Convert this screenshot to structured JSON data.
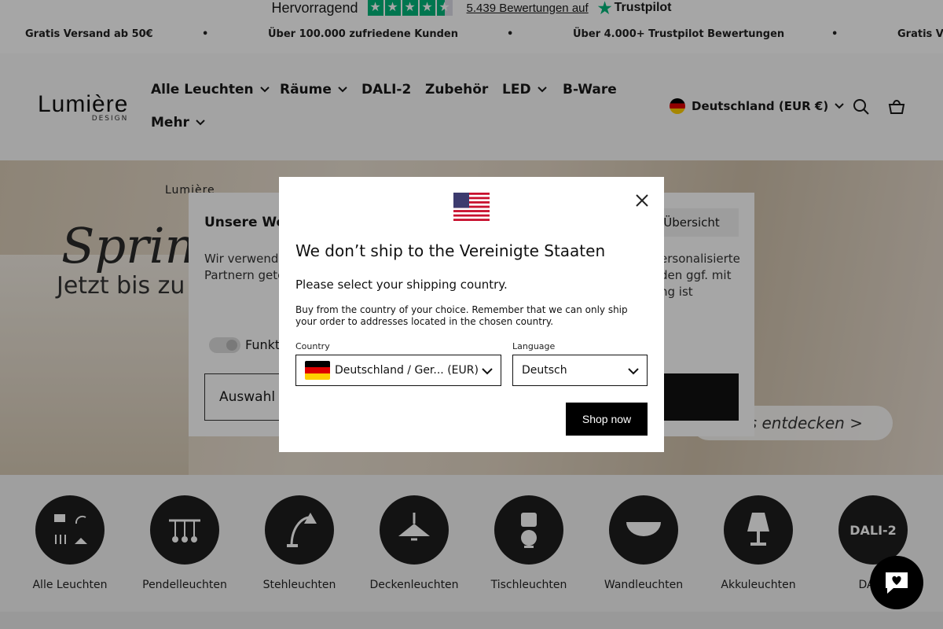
{
  "trustpilot": {
    "rating_text": "Hervorragend",
    "reviews_link": "5.439 Bewertungen auf",
    "brand": "Trustpilot"
  },
  "announcements": [
    "Gratis Versand ab 50€",
    "•",
    "Über 100.000 zufriedene Kunden",
    "•",
    "Über 4.000+ Trustpilot Bewertungen",
    "•",
    "Gratis Ve"
  ],
  "header": {
    "logo": "Lumière",
    "logo_sub": "DESIGN",
    "nav": [
      "Alle Leuchten",
      "Räume",
      "DALI-2",
      "Zubehör",
      "LED",
      "B-Ware",
      "Mehr"
    ],
    "country_selector": "Deutschland (EUR €)"
  },
  "hero": {
    "logo": "Lumière",
    "title": "Spring",
    "subtitle": "Jetzt bis zu",
    "cta": "ns entdecken >"
  },
  "cookie": {
    "title": "Unsere We",
    "text_left": "Wir verwende Inhalte/Werbu Partnern gete freiwillig und j",
    "text_right": "ersonalisierte den ggf. mit ng ist",
    "overview": "Übersicht",
    "toggle_label": "Funkt",
    "select_label": "Auswahl a"
  },
  "categories": [
    "Alle Leuchten",
    "Pendelleuchten",
    "Stehleuchten",
    "Deckenleuchten",
    "Tischleuchten",
    "Wandleuchten",
    "Akkuleuchten",
    "DALI-"
  ],
  "dali_circle": "DALI-2",
  "modal": {
    "title": "We don’t ship to the Vereinigte Staaten",
    "subtitle": "Please select your shipping country.",
    "description": "Buy from the country of your choice. Remember that we can only ship your order to addresses located in the chosen country.",
    "country_label": "Country",
    "country_value": "Deutschland / Ger... (EUR)",
    "language_label": "Language",
    "language_value": "Deutsch",
    "shop_button": "Shop now"
  },
  "colors": {
    "trustpilot_green": "#00b67a",
    "overlay": "rgba(0,0,0,0.35)",
    "button_black": "#000000"
  }
}
